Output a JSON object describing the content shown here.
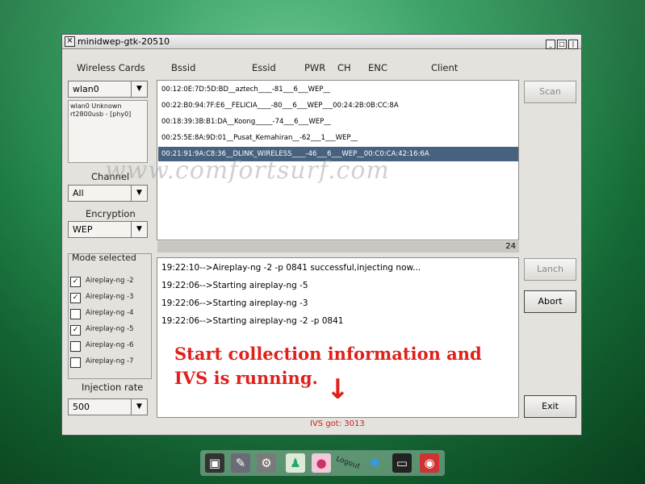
{
  "window": {
    "title": "minidwep-gtk-20510",
    "close_glyph": "⨯"
  },
  "headers": {
    "wireless_cards": "Wireless Cards",
    "bssid": "Bssid",
    "essid": "Essid",
    "pwr": "PWR",
    "ch": "CH",
    "enc": "ENC",
    "client": "Client"
  },
  "card": {
    "selected": "wlan0",
    "info_line1": "wlan0 Unknown",
    "info_line2": "rt2800usb - [phy0]"
  },
  "channel": {
    "label": "Channel",
    "selected": "All"
  },
  "encryption": {
    "label": "Encryption",
    "selected": "WEP"
  },
  "networks": [
    "00:12:0E:7D:5D:BD__aztech____-81___6___WEP__",
    "00:22:B0:94:7F:E6__FELICIA____-80___6___WEP___00:24:2B:0B:CC:8A",
    "00:18:39:3B:B1:DA__Koong_____-74___6___WEP__",
    "00:25:5E:8A:9D:01__Pusat_Kemahiran__-62___1___WEP__",
    "00:21:91:9A:C8:36__DLINK_WIRELESS____-46___6___WEP__00:C0:CA:42:16:6A"
  ],
  "selected_network_index": 4,
  "network_count": "24",
  "buttons": {
    "scan": "Scan",
    "lanch": "Lanch",
    "abort": "Abort",
    "exit": "Exit"
  },
  "mode": {
    "title": "Mode selected",
    "options": [
      {
        "label": "Aireplay-ng -2",
        "checked": true
      },
      {
        "label": "Aireplay-ng -3",
        "checked": true
      },
      {
        "label": "Aireplay-ng -4",
        "checked": false
      },
      {
        "label": "Aireplay-ng -5",
        "checked": true
      },
      {
        "label": "Aireplay-ng -6",
        "checked": false
      },
      {
        "label": "Aireplay-ng -7",
        "checked": false
      }
    ]
  },
  "injection": {
    "label": "Injection rate",
    "selected": "500"
  },
  "log": [
    "19:22:10-->Aireplay-ng -2 -p 0841 successful,injecting now...",
    "19:22:06-->Starting aireplay-ng -5",
    "19:22:06-->Starting aireplay-ng -3",
    "19:22:06-->Starting aireplay-ng -2 -p 0841"
  ],
  "annotation": {
    "line1": "Start collection information and",
    "line2": "IVS is running.",
    "arrow_glyph": "↓"
  },
  "ivs_status": "IVS got: 3013",
  "watermark": "www.comfortsurf.com",
  "dock": {
    "items": [
      "terminal-icon",
      "settings-icon",
      "gear-icon",
      "shirt-icon",
      "mouse-icon",
      "logout-icon",
      "network-icon",
      "console-icon",
      "camera-icon"
    ],
    "logout_text": "Logout"
  },
  "colors": {
    "selection": "#46627e",
    "annotation": "#e0201b",
    "ivs": "#c0241c"
  }
}
